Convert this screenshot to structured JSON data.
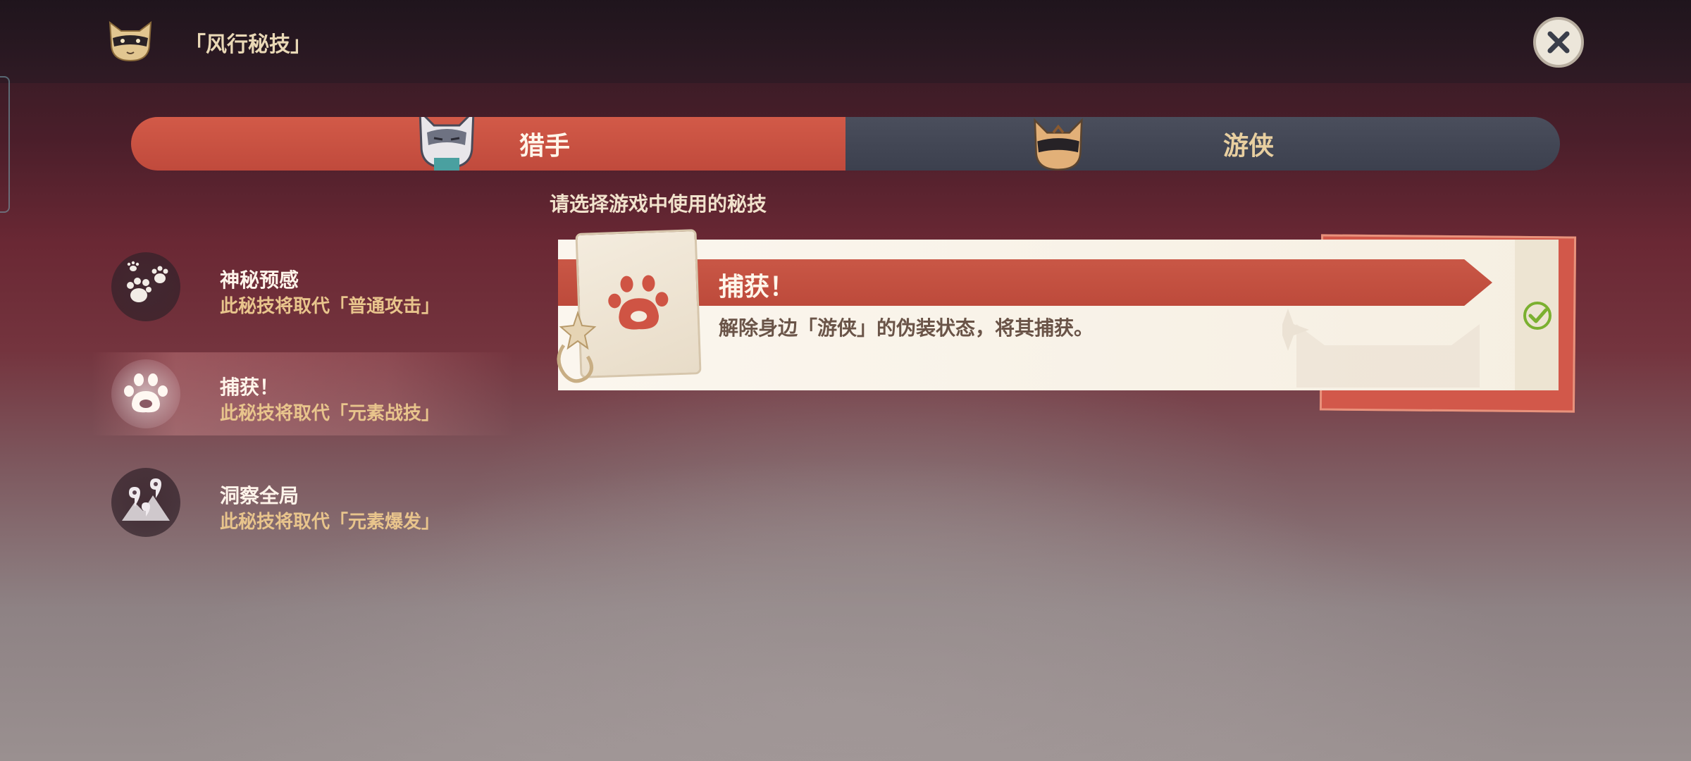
{
  "header": {
    "title": "「风行秘技」",
    "close_icon": "close-icon"
  },
  "tabs": [
    {
      "label": "猎手",
      "selected": true,
      "color": "#c8503f"
    },
    {
      "label": "游侠",
      "selected": false,
      "color": "#434756"
    }
  ],
  "instruction": "请选择游戏中使用的秘技",
  "skills": [
    {
      "name": "神秘预感",
      "desc": "此秘技将取代「普通攻击」",
      "icon": "paw-prints-icon",
      "selected": false
    },
    {
      "name": "捕获！",
      "desc": "此秘技将取代「元素战技」",
      "icon": "paw-icon",
      "selected": true
    },
    {
      "name": "洞察全局",
      "desc": "此秘技将取代「元素爆发」",
      "icon": "map-pins-icon",
      "selected": false
    }
  ],
  "detail": {
    "title": "捕获！",
    "desc": "解除身边「游侠」的伪装状态，将其捕获。",
    "icon": "paw-icon",
    "equipped_icon": "check-icon"
  },
  "colors": {
    "accent_red": "#c8503f",
    "gold_text": "#e8c48c",
    "check_green": "#7bb030"
  }
}
